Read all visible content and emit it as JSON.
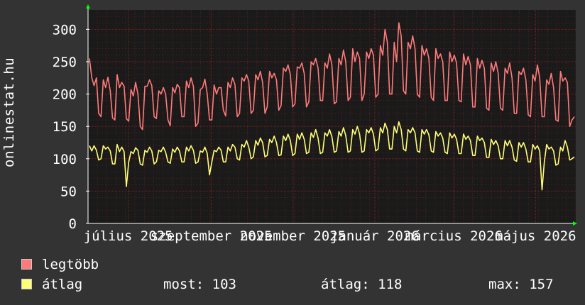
{
  "side_label": "onlinestat.hu",
  "colors": {
    "background": "#333333",
    "plot_background": "#1a1a1a",
    "grid": "#7a2020",
    "max_series": "#ff7b7b",
    "avg_series": "#ffff77",
    "arrow": "#00ff00"
  },
  "legend": {
    "max_label": "legtöbb",
    "avg_label": "átlag"
  },
  "stats": {
    "current": "most: 103",
    "average": "átlag: 118",
    "maximum": "max: 157"
  },
  "chart_data": {
    "type": "line",
    "ylim": [
      0,
      330
    ],
    "y_ticks": [
      0,
      50,
      100,
      150,
      200,
      250,
      300
    ],
    "x_tick_labels": [
      "július 2025",
      "szeptember 2025",
      "november 2025",
      "január 2026",
      "március 2026",
      "május 2026"
    ],
    "x_start": "2025-06-01",
    "x_end": "2026-05-31",
    "x_tick_dates": [
      "2025-07-01",
      "2025-09-01",
      "2025-11-01",
      "2026-01-01",
      "2026-03-01",
      "2026-05-01"
    ],
    "grid": true,
    "series": [
      {
        "name": "legtöbb",
        "color": "#ff7b7b",
        "values": [
          255,
          225,
          213,
          225,
          170,
          165,
          222,
          210,
          226,
          205,
          163,
          160,
          230,
          210,
          218,
          212,
          162,
          158,
          207,
          197,
          218,
          200,
          150,
          145,
          212,
          212,
          222,
          213,
          165,
          162,
          205,
          200,
          210,
          200,
          160,
          151,
          210,
          202,
          215,
          210,
          165,
          165,
          220,
          210,
          225,
          212,
          150,
          155,
          207,
          210,
          223,
          200,
          160,
          160,
          214,
          200,
          210,
          210,
          175,
          166,
          218,
          210,
          225,
          215,
          165,
          170,
          225,
          220,
          230,
          220,
          170,
          175,
          230,
          222,
          235,
          218,
          170,
          180,
          235,
          225,
          232,
          222,
          175,
          182,
          240,
          235,
          245,
          230,
          180,
          185,
          242,
          240,
          248,
          232,
          180,
          188,
          250,
          245,
          255,
          240,
          190,
          190,
          248,
          240,
          262,
          245,
          185,
          188,
          255,
          245,
          268,
          250,
          190,
          195,
          270,
          250,
          265,
          255,
          190,
          200,
          265,
          255,
          270,
          260,
          195,
          200,
          275,
          260,
          300,
          280,
          200,
          200,
          280,
          250,
          310,
          290,
          205,
          200,
          280,
          270,
          290,
          270,
          200,
          195,
          275,
          260,
          270,
          255,
          195,
          190,
          270,
          255,
          262,
          250,
          190,
          190,
          265,
          250,
          260,
          248,
          190,
          188,
          262,
          245,
          258,
          245,
          180,
          180,
          255,
          240,
          252,
          240,
          178,
          175,
          248,
          235,
          250,
          232,
          178,
          175,
          240,
          232,
          248,
          225,
          170,
          170,
          235,
          230,
          240,
          222,
          168,
          165,
          230,
          220,
          245,
          225,
          165,
          165,
          222,
          215,
          232,
          210,
          160,
          158,
          235,
          220,
          225,
          218,
          150,
          160,
          165
        ]
      },
      {
        "name": "átlag",
        "color": "#ffff77",
        "values": [
          120,
          112,
          120,
          113,
          98,
          100,
          120,
          115,
          118,
          112,
          92,
          92,
          122,
          111,
          118,
          111,
          57,
          95,
          111,
          108,
          117,
          113,
          92,
          90,
          113,
          110,
          118,
          112,
          92,
          95,
          113,
          111,
          118,
          110,
          95,
          93,
          115,
          110,
          118,
          112,
          95,
          95,
          118,
          112,
          120,
          113,
          93,
          95,
          112,
          110,
          118,
          108,
          75,
          95,
          113,
          111,
          118,
          113,
          95,
          95,
          118,
          112,
          122,
          118,
          100,
          98,
          122,
          118,
          128,
          118,
          100,
          103,
          128,
          121,
          132,
          125,
          103,
          105,
          130,
          125,
          135,
          125,
          105,
          106,
          135,
          128,
          138,
          128,
          105,
          108,
          138,
          130,
          140,
          130,
          108,
          110,
          140,
          133,
          145,
          132,
          108,
          110,
          140,
          135,
          145,
          134,
          110,
          112,
          142,
          135,
          148,
          136,
          110,
          112,
          145,
          138,
          150,
          138,
          110,
          112,
          145,
          140,
          148,
          138,
          112,
          115,
          148,
          140,
          155,
          145,
          115,
          115,
          150,
          140,
          157,
          145,
          115,
          112,
          145,
          140,
          148,
          140,
          112,
          110,
          145,
          138,
          145,
          137,
          112,
          110,
          142,
          135,
          140,
          132,
          110,
          108,
          140,
          132,
          138,
          130,
          108,
          108,
          138,
          130,
          135,
          128,
          105,
          105,
          135,
          128,
          132,
          125,
          102,
          102,
          130,
          122,
          128,
          120,
          100,
          100,
          128,
          120,
          128,
          118,
          98,
          96,
          125,
          118,
          125,
          115,
          95,
          95,
          122,
          115,
          120,
          112,
          52,
          95,
          122,
          115,
          118,
          112,
          90,
          92,
          118,
          112,
          128,
          118,
          98,
          100,
          103
        ]
      }
    ]
  }
}
